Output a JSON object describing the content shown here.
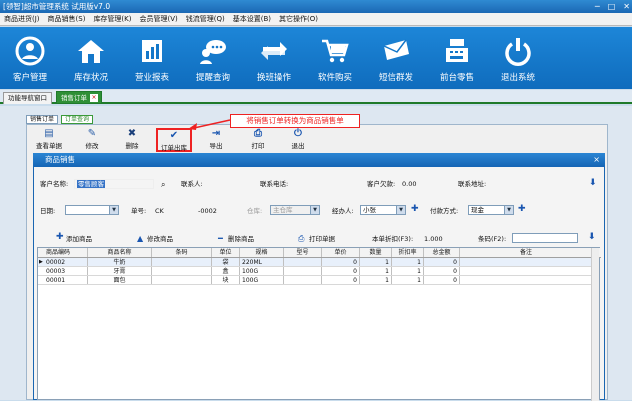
{
  "window": {
    "title": "[领智]超市管理系统 试用版v7.0"
  },
  "menubar": [
    "商品进货(J)",
    "商品销售(S)",
    "库存管理(K)",
    "会员管理(V)",
    "钱流管理(Q)",
    "基本设置(B)",
    "其它操作(O)"
  ],
  "toolbar": [
    {
      "label": "客户管理",
      "icon": "person-icon"
    },
    {
      "label": "库存状况",
      "icon": "house-icon"
    },
    {
      "label": "营业报表",
      "icon": "report-icon"
    },
    {
      "label": "提醒查询",
      "icon": "chat-icon"
    },
    {
      "label": "换班操作",
      "icon": "swap-icon"
    },
    {
      "label": "软件购买",
      "icon": "cart-icon"
    },
    {
      "label": "短信群发",
      "icon": "envelope-icon"
    },
    {
      "label": "前台零售",
      "icon": "register-icon"
    },
    {
      "label": "退出系统",
      "icon": "power-icon"
    }
  ],
  "tabs": {
    "nav": "功能导航窗口",
    "active": "销售订单",
    "close": "×"
  },
  "subtabs": {
    "list": "销售订单",
    "query": "订单查询"
  },
  "actions": {
    "view": "查看单据",
    "edit": "修改",
    "delete": "删除",
    "to_out": "订单出库",
    "export": "导出",
    "print": "打印",
    "exit": "退出"
  },
  "callout": "将销售订单转换为商品销售单",
  "dialog": {
    "title": "商品销售",
    "close": "×",
    "customer_label": "客户名称:",
    "customer_value": "零售顾客",
    "contact_label": "联系人:",
    "phone_label": "联系电话:",
    "debt_label": "客户欠款:",
    "debt_value": "0.00",
    "address_label": "联系地址:",
    "date_label": "日期:",
    "docno_label": "单号:",
    "docno_prefix": "CK",
    "docno_suffix": "-0002",
    "warehouse_label": "仓库:",
    "warehouse_value": "主仓库",
    "handler_label": "经办人:",
    "handler_value": "小张",
    "payment_label": "付款方式:",
    "payment_value": "现金",
    "add_goods": "添加商品",
    "edit_goods": "修改商品",
    "delete_goods": "删除商品",
    "print_doc": "打印单据",
    "discount_label": "本单折扣(F3):",
    "discount_value": "1.000",
    "barcode_label": "条码(F2):"
  },
  "table": {
    "columns": [
      "商品编码",
      "商品名称",
      "条码",
      "单位",
      "规格",
      "型号",
      "单价",
      "数量",
      "折扣率",
      "总金额",
      "备注"
    ],
    "rows": [
      [
        "00002",
        "牛奶",
        "",
        "袋",
        "220ML",
        "",
        "0",
        "1",
        "1",
        "0",
        ""
      ],
      [
        "00003",
        "牙膏",
        "",
        "盒",
        "100G",
        "",
        "0",
        "1",
        "1",
        "0",
        ""
      ],
      [
        "00001",
        "面包",
        "",
        "块",
        "100G",
        "",
        "0",
        "1",
        "1",
        "0",
        ""
      ]
    ]
  },
  "colors": {
    "toolbar": "#1277c8",
    "dialog_title": "#1b6fc0",
    "callout": "#e22222",
    "active_tab": "#2f8f36"
  }
}
